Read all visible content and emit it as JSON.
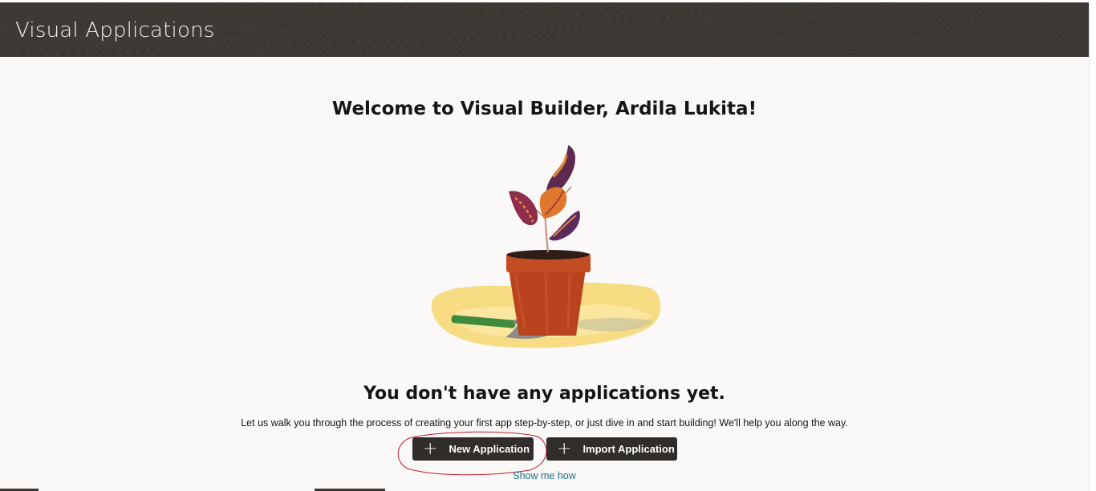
{
  "header": {
    "app_title": "Visual Applications"
  },
  "main": {
    "welcome": "Welcome to Visual Builder, Ardila Lukita!",
    "empty_title": "You don't have any applications yet.",
    "subtitle": "Let us walk you through the process of creating your first app step-by-step, or just dive in and start building! We'll help you along the way.",
    "new_button": "New Application",
    "import_button": "Import Application",
    "plus_glyph": "+",
    "show_me_link": "Show me how"
  },
  "colors": {
    "header_bg": "#3a3632",
    "page_bg": "#fbf9f8",
    "button_bg": "#312d2a",
    "link": "#1b6c8c",
    "annotation_circle": "#c0192a"
  },
  "icons": [
    "plus-icon",
    "plant-illustration"
  ]
}
